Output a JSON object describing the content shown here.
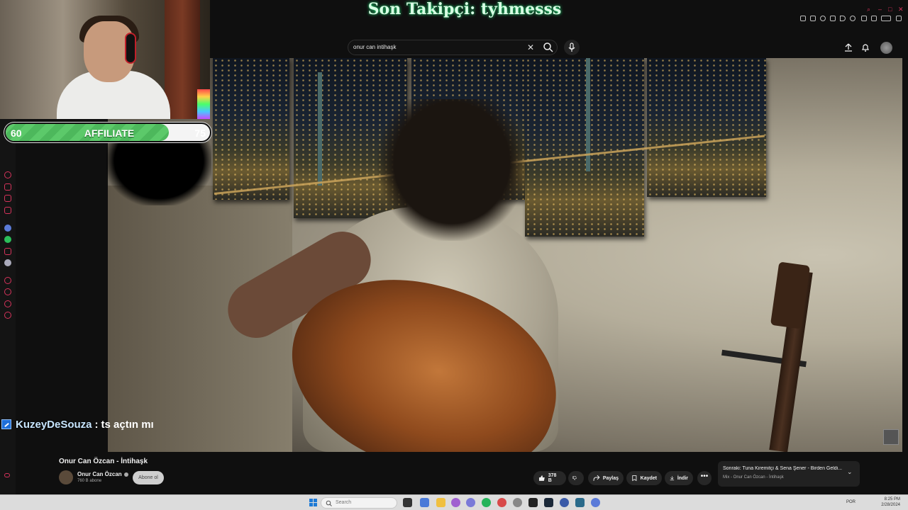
{
  "overlay": {
    "last_follower": "Son Takipçi: tyhmesss",
    "affiliate": {
      "label": "AFFILIATE",
      "current": "60",
      "goal": "75",
      "progress": 0.8
    }
  },
  "chat": {
    "username": "KuzeyDeSouza",
    "separator": ":",
    "message": "ts açtın mı"
  },
  "youtube": {
    "search": {
      "value": "onur can intihaşk"
    },
    "video": {
      "title": "Onur Can Özcan - İntihaşk",
      "channel_name": "Onur Can Özcan",
      "subscribers": "760 B abone",
      "subscribe_label": "Abone ol",
      "likes": "378 B",
      "share_label": "Paylaş",
      "save_label": "Kaydet",
      "download_label": "İndir",
      "more_label": "•••"
    },
    "up_next": {
      "title": "Sonraki: Tuna Kiremitçi & Sena Şener - Birden Geldi...",
      "subtitle": "Mix - Onur Can Özcan - İntihaşk"
    }
  },
  "taskbar": {
    "search_placeholder": "Search",
    "language": "POR",
    "time": "8:25 PM",
    "date": "2/28/2024"
  },
  "colors": {
    "accent": "#d6335b",
    "affiliate_green": "#5cc96a",
    "overlay_glow": "#2aff8a"
  }
}
